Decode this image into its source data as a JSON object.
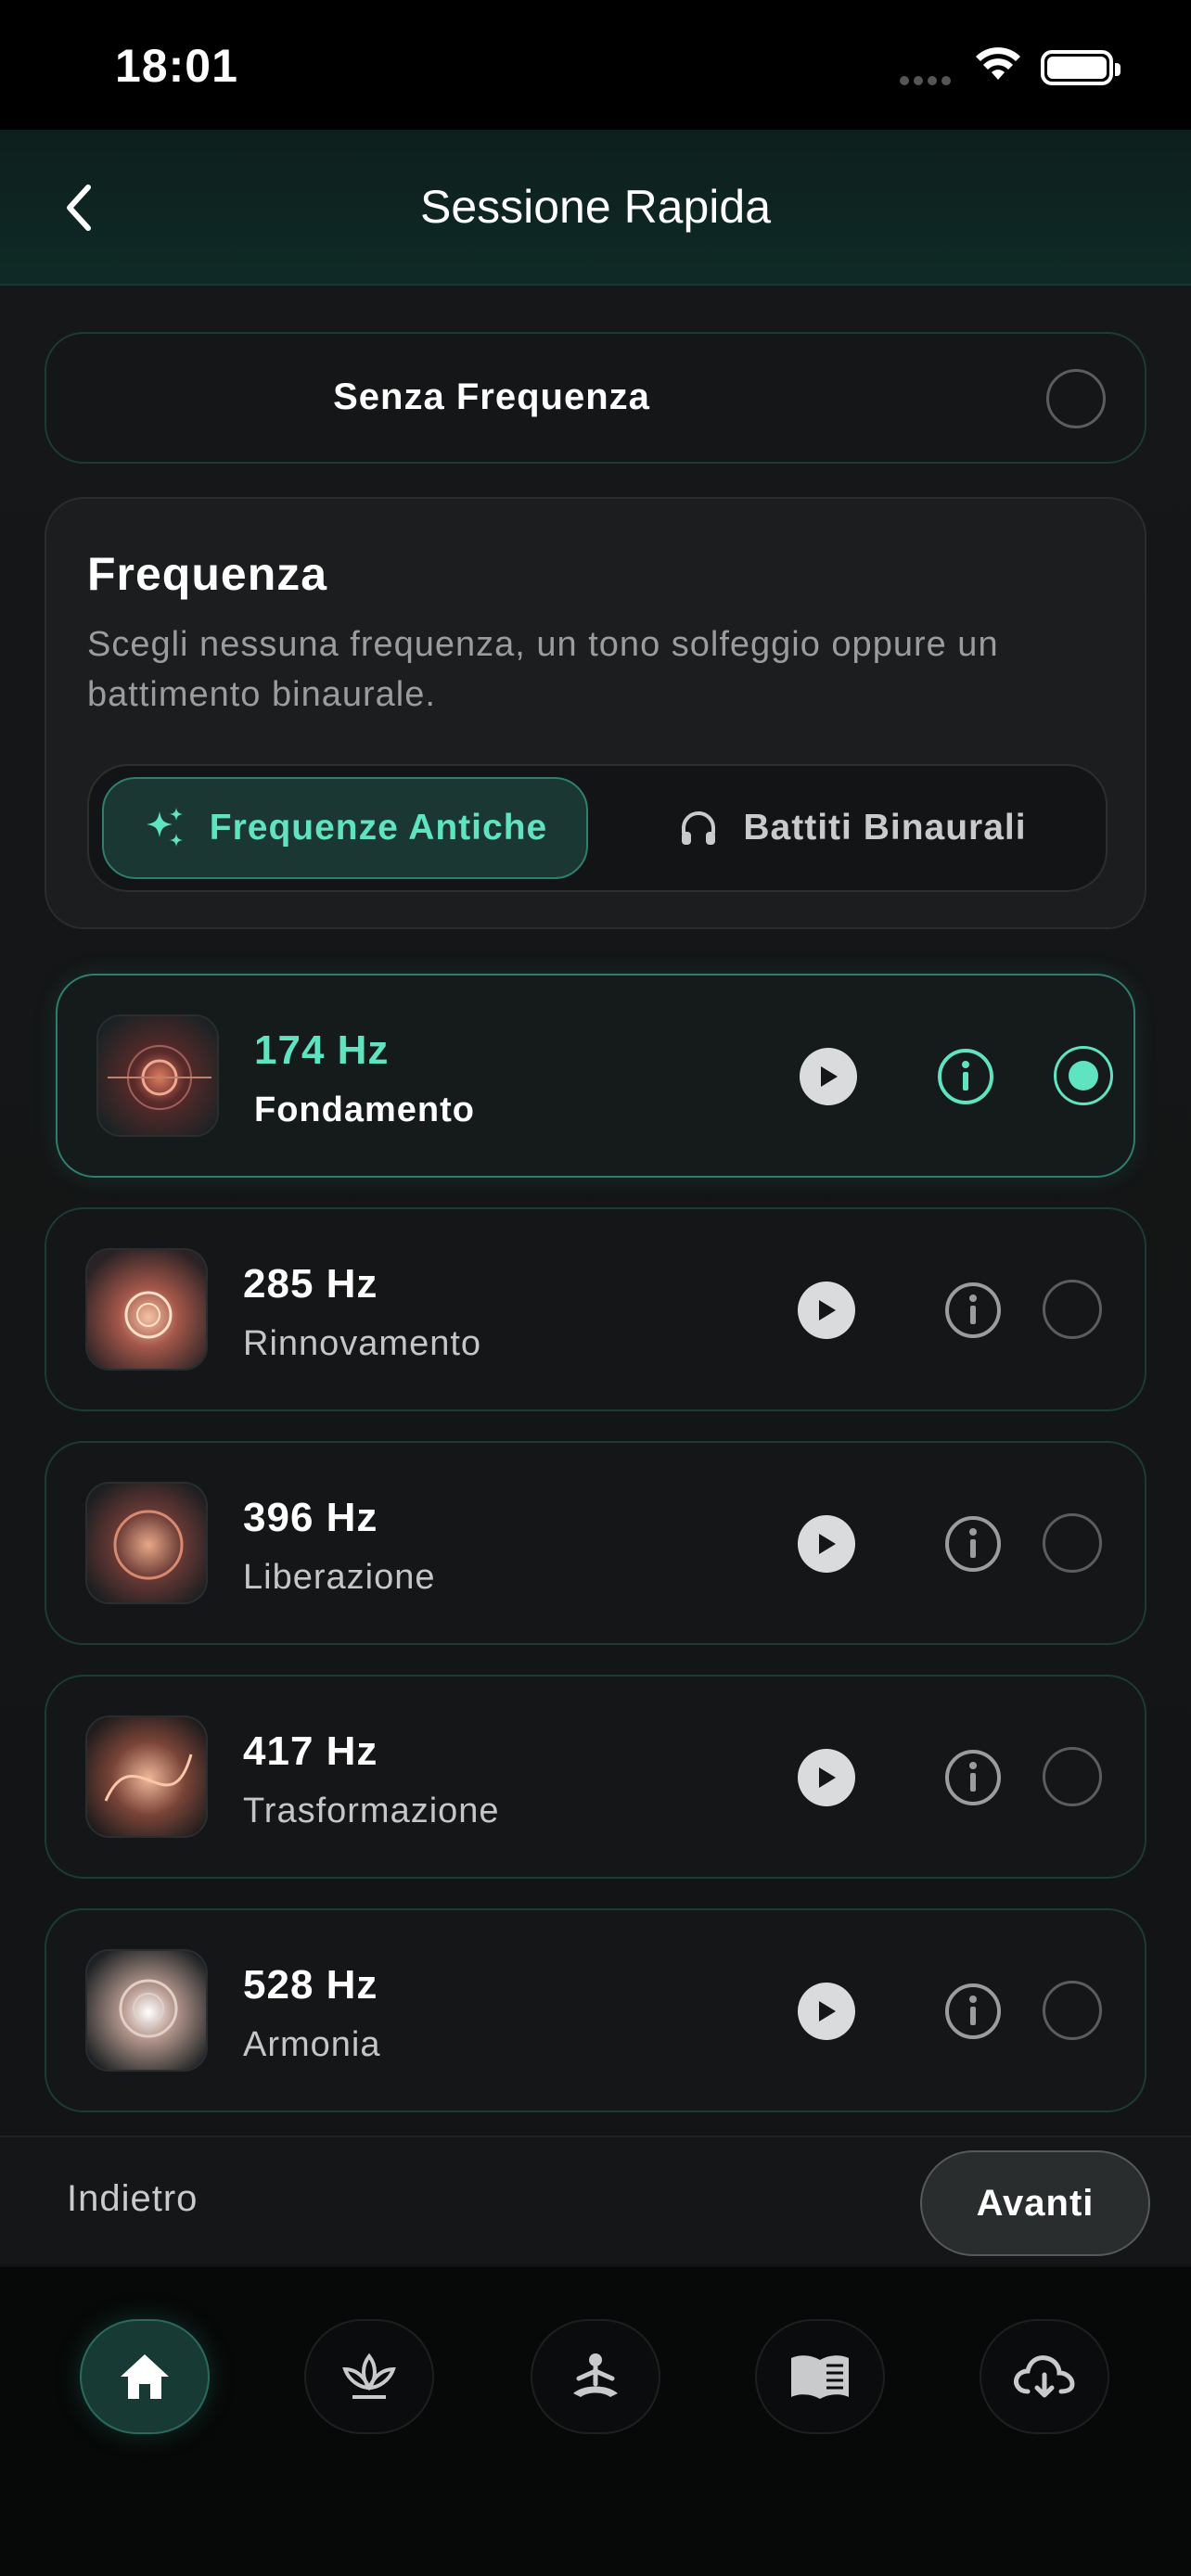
{
  "status_bar": {
    "time": "18:01"
  },
  "header": {
    "title": "Sessione Rapida"
  },
  "no_frequency": {
    "label": "Senza Frequenza",
    "selected": false
  },
  "frequency_panel": {
    "title": "Frequenza",
    "description": "Scegli nessuna frequenza, un tono solfeggio oppure un battimento binaurale.",
    "tabs": [
      {
        "label": "Frequenze Antiche",
        "icon": "sparkles-icon",
        "active": true
      },
      {
        "label": "Battiti Binaurali",
        "icon": "headphones-icon",
        "active": false
      }
    ]
  },
  "frequencies": [
    {
      "hz": "174 Hz",
      "name": "Fondamento",
      "selected": true
    },
    {
      "hz": "285 Hz",
      "name": "Rinnovamento",
      "selected": false
    },
    {
      "hz": "396 Hz",
      "name": "Liberazione",
      "selected": false
    },
    {
      "hz": "417 Hz",
      "name": "Trasformazione",
      "selected": false
    },
    {
      "hz": "528 Hz",
      "name": "Armonia",
      "selected": false
    }
  ],
  "actions": {
    "back_label": "Indietro",
    "next_label": "Avanti"
  },
  "tab_bar": [
    {
      "icon": "home-icon",
      "active": true
    },
    {
      "icon": "lotus-icon",
      "active": false
    },
    {
      "icon": "meditation-icon",
      "active": false
    },
    {
      "icon": "book-icon",
      "active": false
    },
    {
      "icon": "cloud-download-icon",
      "active": false
    }
  ],
  "colors": {
    "accent": "#5fe3c1",
    "background": "#0d1011",
    "card": "#141617"
  }
}
